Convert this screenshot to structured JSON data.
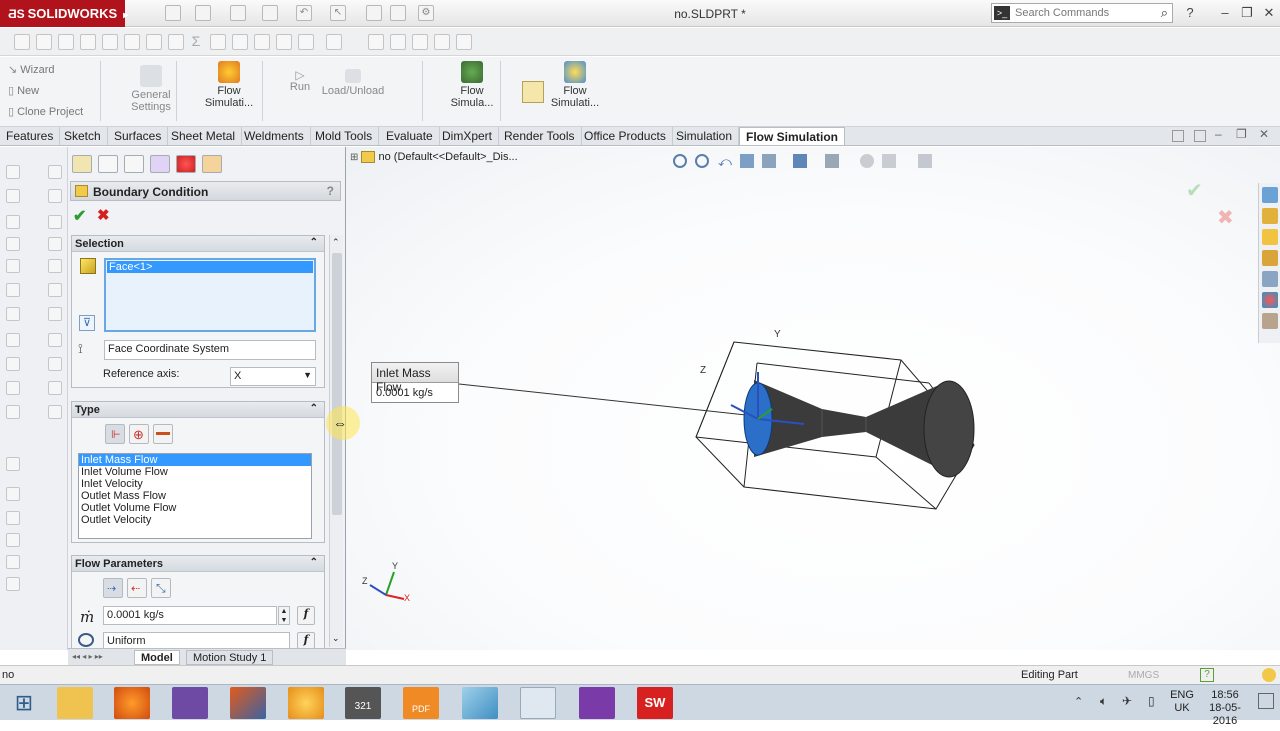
{
  "app": {
    "logo_text": "SOLIDWORKS",
    "document_title": "no.SLDPRT *",
    "search_placeholder": "Search Commands",
    "help": "?"
  },
  "command_manager": {
    "wizard": "Wizard",
    "new": "New",
    "clone_project": "Clone Project",
    "general_settings_1": "General",
    "general_settings_2": "Settings",
    "flow_simulation_a_1": "Flow",
    "flow_simulation_a_2": "Simulati...",
    "run": "Run",
    "load_unload": "Load/Unload",
    "flow_simulation_b_1": "Flow",
    "flow_simulation_b_2": "Simula...",
    "flow_simulation_c_1": "Flow",
    "flow_simulation_c_2": "Simulati..."
  },
  "tabs": [
    "Features",
    "Sketch",
    "Surfaces",
    "Sheet Metal",
    "Weldments",
    "Mold Tools",
    "Evaluate",
    "DimXpert",
    "Render Tools",
    "Office Products",
    "Simulation",
    "Flow Simulation"
  ],
  "property_manager": {
    "title": "Boundary Condition",
    "help": "?",
    "selection": {
      "header": "Selection",
      "selected_face": "Face<1>",
      "coordinate_system": "Face Coordinate System",
      "reference_axis_label": "Reference axis:",
      "reference_axis_value": "X"
    },
    "type": {
      "header": "Type",
      "items": [
        "Inlet Mass Flow",
        "Inlet Volume Flow",
        "Inlet Velocity",
        "Outlet Mass Flow",
        "Outlet Volume Flow",
        "Outlet Velocity"
      ],
      "selected_index": 0
    },
    "flow_parameters": {
      "header": "Flow Parameters",
      "symbol": "ṁ",
      "mass_flow_value": "0.0001 kg/s",
      "profile": "Uniform",
      "fx": "f"
    }
  },
  "bottom_tabs": [
    "Model",
    "Motion Study 1"
  ],
  "viewport": {
    "tree_label": "no  (Default<<Default>_Dis...",
    "callout_title": "Inlet Mass Flow",
    "callout_value": "0.0001 kg/s",
    "axis_x": "X",
    "axis_y": "Y",
    "axis_z": "Z"
  },
  "status_bar": {
    "left": "no",
    "editing": "Editing Part",
    "units": "MMGS",
    "help": "?"
  },
  "taskbar": {
    "language_1": "ENG",
    "language_2": "UK",
    "time": "18:56",
    "date": "18-05-2016",
    "calendar_number": "321",
    "pdf_label": "PDF",
    "sw_label": "SW"
  }
}
